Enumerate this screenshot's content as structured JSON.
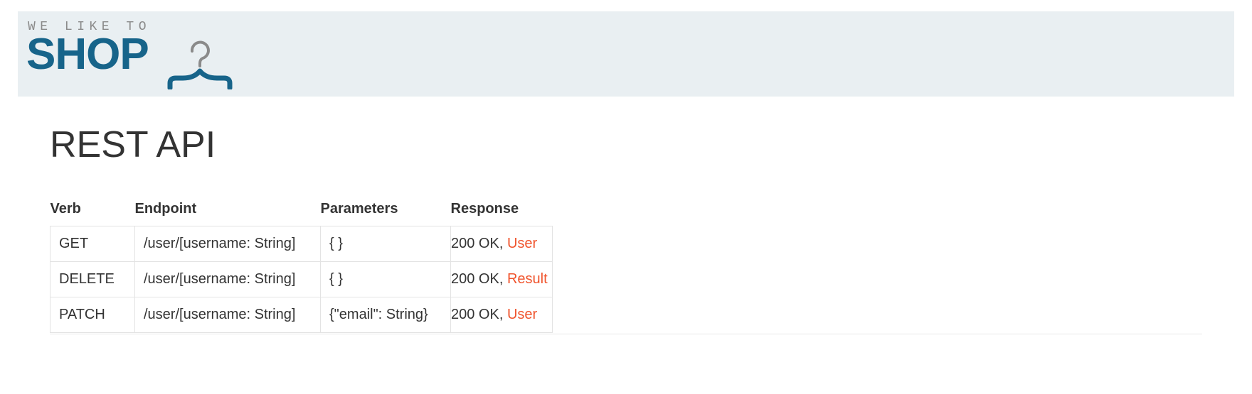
{
  "header": {
    "logo": {
      "tagline": "WE LIKE TO",
      "name": "SHOP",
      "icon": "hanger-icon"
    }
  },
  "main": {
    "title": "REST API",
    "table": {
      "headers": {
        "verb": "Verb",
        "endpoint": "Endpoint",
        "parameters": "Parameters",
        "response": "Response"
      },
      "rows": [
        {
          "verb": "GET",
          "endpoint": "/user/[username: String]",
          "parameters": "{ }",
          "status": "200 OK, ",
          "type": "User"
        },
        {
          "verb": "DELETE",
          "endpoint": "/user/[username: String]",
          "parameters": "{ }",
          "status": "200 OK, ",
          "type": "Result"
        },
        {
          "verb": "PATCH",
          "endpoint": "/user/[username: String]",
          "parameters": "{\"email\": String}",
          "status": "200 OK, ",
          "type": "User"
        }
      ]
    }
  },
  "colors": {
    "header_bg": "#e9eff2",
    "brand": "#17648a",
    "link": "#f0542d",
    "text": "#333333"
  }
}
